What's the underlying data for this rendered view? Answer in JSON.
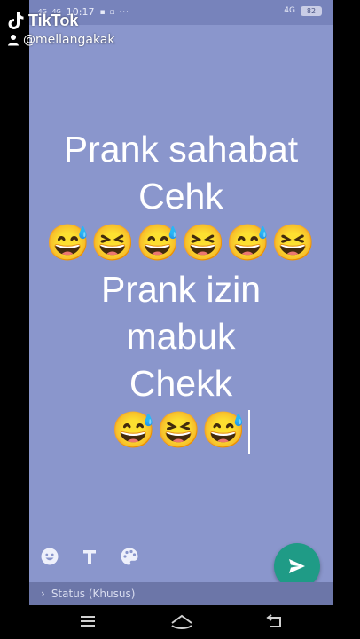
{
  "status_bar": {
    "time": "10:17",
    "network_left": [
      "4G",
      "4G"
    ],
    "notification_icons": "▪ ▫ ···",
    "network_right": "4G",
    "battery": "82"
  },
  "watermark": {
    "app_name": "TikTok",
    "username": "@mellangakak"
  },
  "story": {
    "line1": "Prank sahabat",
    "line2": "Cehk",
    "emoji_row1": "😅😆😅😆😅😆",
    "line3": "Prank izin",
    "line4": "mabuk",
    "line5": "Chekk",
    "emoji_row2": "😅😆😅"
  },
  "toolbar": {
    "emoji_icon": "emoji-icon",
    "text_icon": "text-icon",
    "palette_icon": "palette-icon",
    "send_icon": "send-icon"
  },
  "bottom": {
    "status_label": "Status (Khusus)"
  },
  "colors": {
    "background": "#8a96cc",
    "send_button": "#1f9b86"
  }
}
